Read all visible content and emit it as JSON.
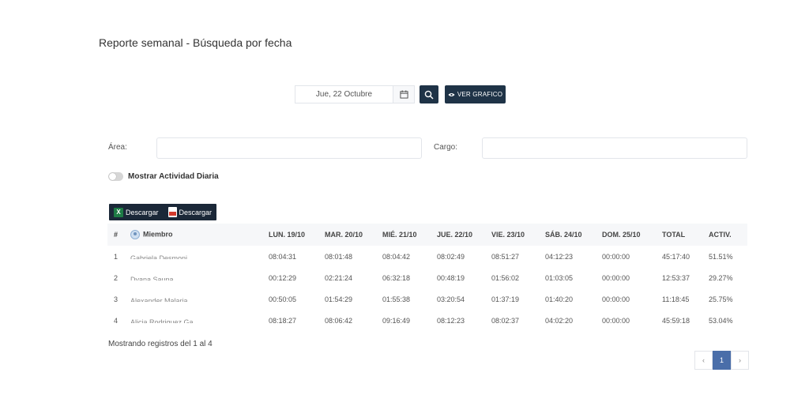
{
  "page_title": "Reporte semanal - Búsqueda por fecha",
  "date_picker": {
    "value": "Jue, 22 Octubre"
  },
  "buttons": {
    "ver_grafico": "VER GRAFICO"
  },
  "filters": {
    "area_label": "Área:",
    "cargo_label": "Cargo:",
    "area_value": "",
    "cargo_value": ""
  },
  "toggle": {
    "label": "Mostrar Actividad Diaria",
    "on": false
  },
  "downloads": {
    "excel_label": "Descargar",
    "pdf_label": "Descargar"
  },
  "table": {
    "headers": [
      "#",
      "Miembro",
      "LUN. 19/10",
      "MAR. 20/10",
      "MIÉ. 21/10",
      "JUE. 22/10",
      "VIE. 23/10",
      "SÁB. 24/10",
      "DOM. 25/10",
      "TOTAL",
      "ACTIV."
    ],
    "rows": [
      [
        "1",
        "Gabriela Desmoni",
        "08:04:31",
        "08:01:48",
        "08:04:42",
        "08:02:49",
        "08:51:27",
        "04:12:23",
        "00:00:00",
        "45:17:40",
        "51.51%"
      ],
      [
        "2",
        "Dyana Sauna",
        "00:12:29",
        "02:21:24",
        "06:32:18",
        "00:48:19",
        "01:56:02",
        "01:03:05",
        "00:00:00",
        "12:53:37",
        "29.27%"
      ],
      [
        "3",
        "Alexander Malaria",
        "00:50:05",
        "01:54:29",
        "01:55:38",
        "03:20:54",
        "01:37:19",
        "01:40:20",
        "00:00:00",
        "11:18:45",
        "25.75%"
      ],
      [
        "4",
        "Alicia Rodriguez Gabriel",
        "08:18:27",
        "08:06:42",
        "09:16:49",
        "08:12:23",
        "08:02:37",
        "04:02:20",
        "00:00:00",
        "45:59:18",
        "53.04%"
      ]
    ]
  },
  "footer": {
    "records_text": "Mostrando registros del 1 al 4"
  },
  "pagination": {
    "prev": "‹",
    "current": "1",
    "next": "›"
  },
  "colors": {
    "dark_button": "#1f3347",
    "active_page": "#4a6ea9"
  }
}
